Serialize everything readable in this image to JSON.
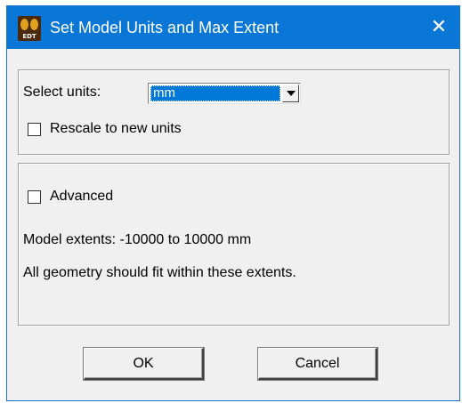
{
  "window": {
    "title": "Set Model Units and Max Extent",
    "app_icon_text": "EDT",
    "close_glyph": "✕",
    "colors": {
      "titlebar": "#0a76d6",
      "face": "#f0f0f0",
      "selection": "#0078d7"
    }
  },
  "units": {
    "label": "Select units:",
    "selected_value": "mm",
    "rescale_label": "Rescale to new units",
    "rescale_checked": false
  },
  "advanced": {
    "label": "Advanced",
    "checked": false,
    "extents_text": "Model extents: -10000 to 10000 mm",
    "note_text": "All geometry should fit within these extents."
  },
  "buttons": {
    "ok_label": "OK",
    "cancel_label": "Cancel"
  }
}
